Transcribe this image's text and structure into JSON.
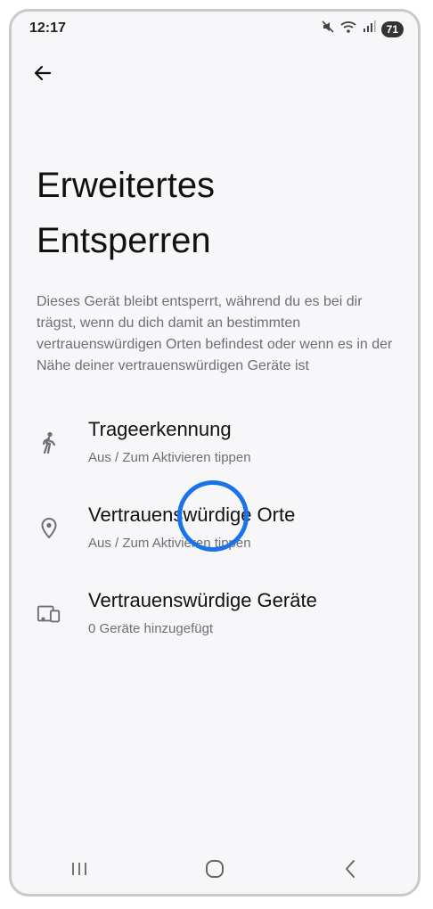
{
  "status_bar": {
    "time": "12:17",
    "battery": "71",
    "icons": [
      "mute-icon",
      "wifi-icon",
      "signal-icon",
      "battery-icon"
    ]
  },
  "header": {
    "back_icon": "arrow-back-icon",
    "title": "Erweitertes Entsperren"
  },
  "description": "Dieses Gerät bleibt entsperrt, während du es bei dir trägst, wenn du dich damit an bestimmten vertrauenswürdigen Orten befindest oder wenn es in der Nähe deiner vertrauenswürdigen Geräte ist",
  "settings": [
    {
      "icon": "walking-person-icon",
      "title": "Trageerkennung",
      "summary": "Aus / Zum Aktivieren tippen"
    },
    {
      "icon": "location-pin-icon",
      "title": "Vertrauenswürdige Orte",
      "summary": "Aus / Zum Aktivieren tippen"
    },
    {
      "icon": "devices-icon",
      "title": "Vertrauenswürdige Geräte",
      "summary": "0 Geräte hinzugefügt"
    }
  ],
  "nav_bar": {
    "icons": [
      "recents-icon",
      "home-icon",
      "back-icon"
    ]
  },
  "colors": {
    "background": "#f7f7f9",
    "text_primary": "#111111",
    "text_secondary": "#6f6f73",
    "tap_indicator": "#1a73e8"
  }
}
